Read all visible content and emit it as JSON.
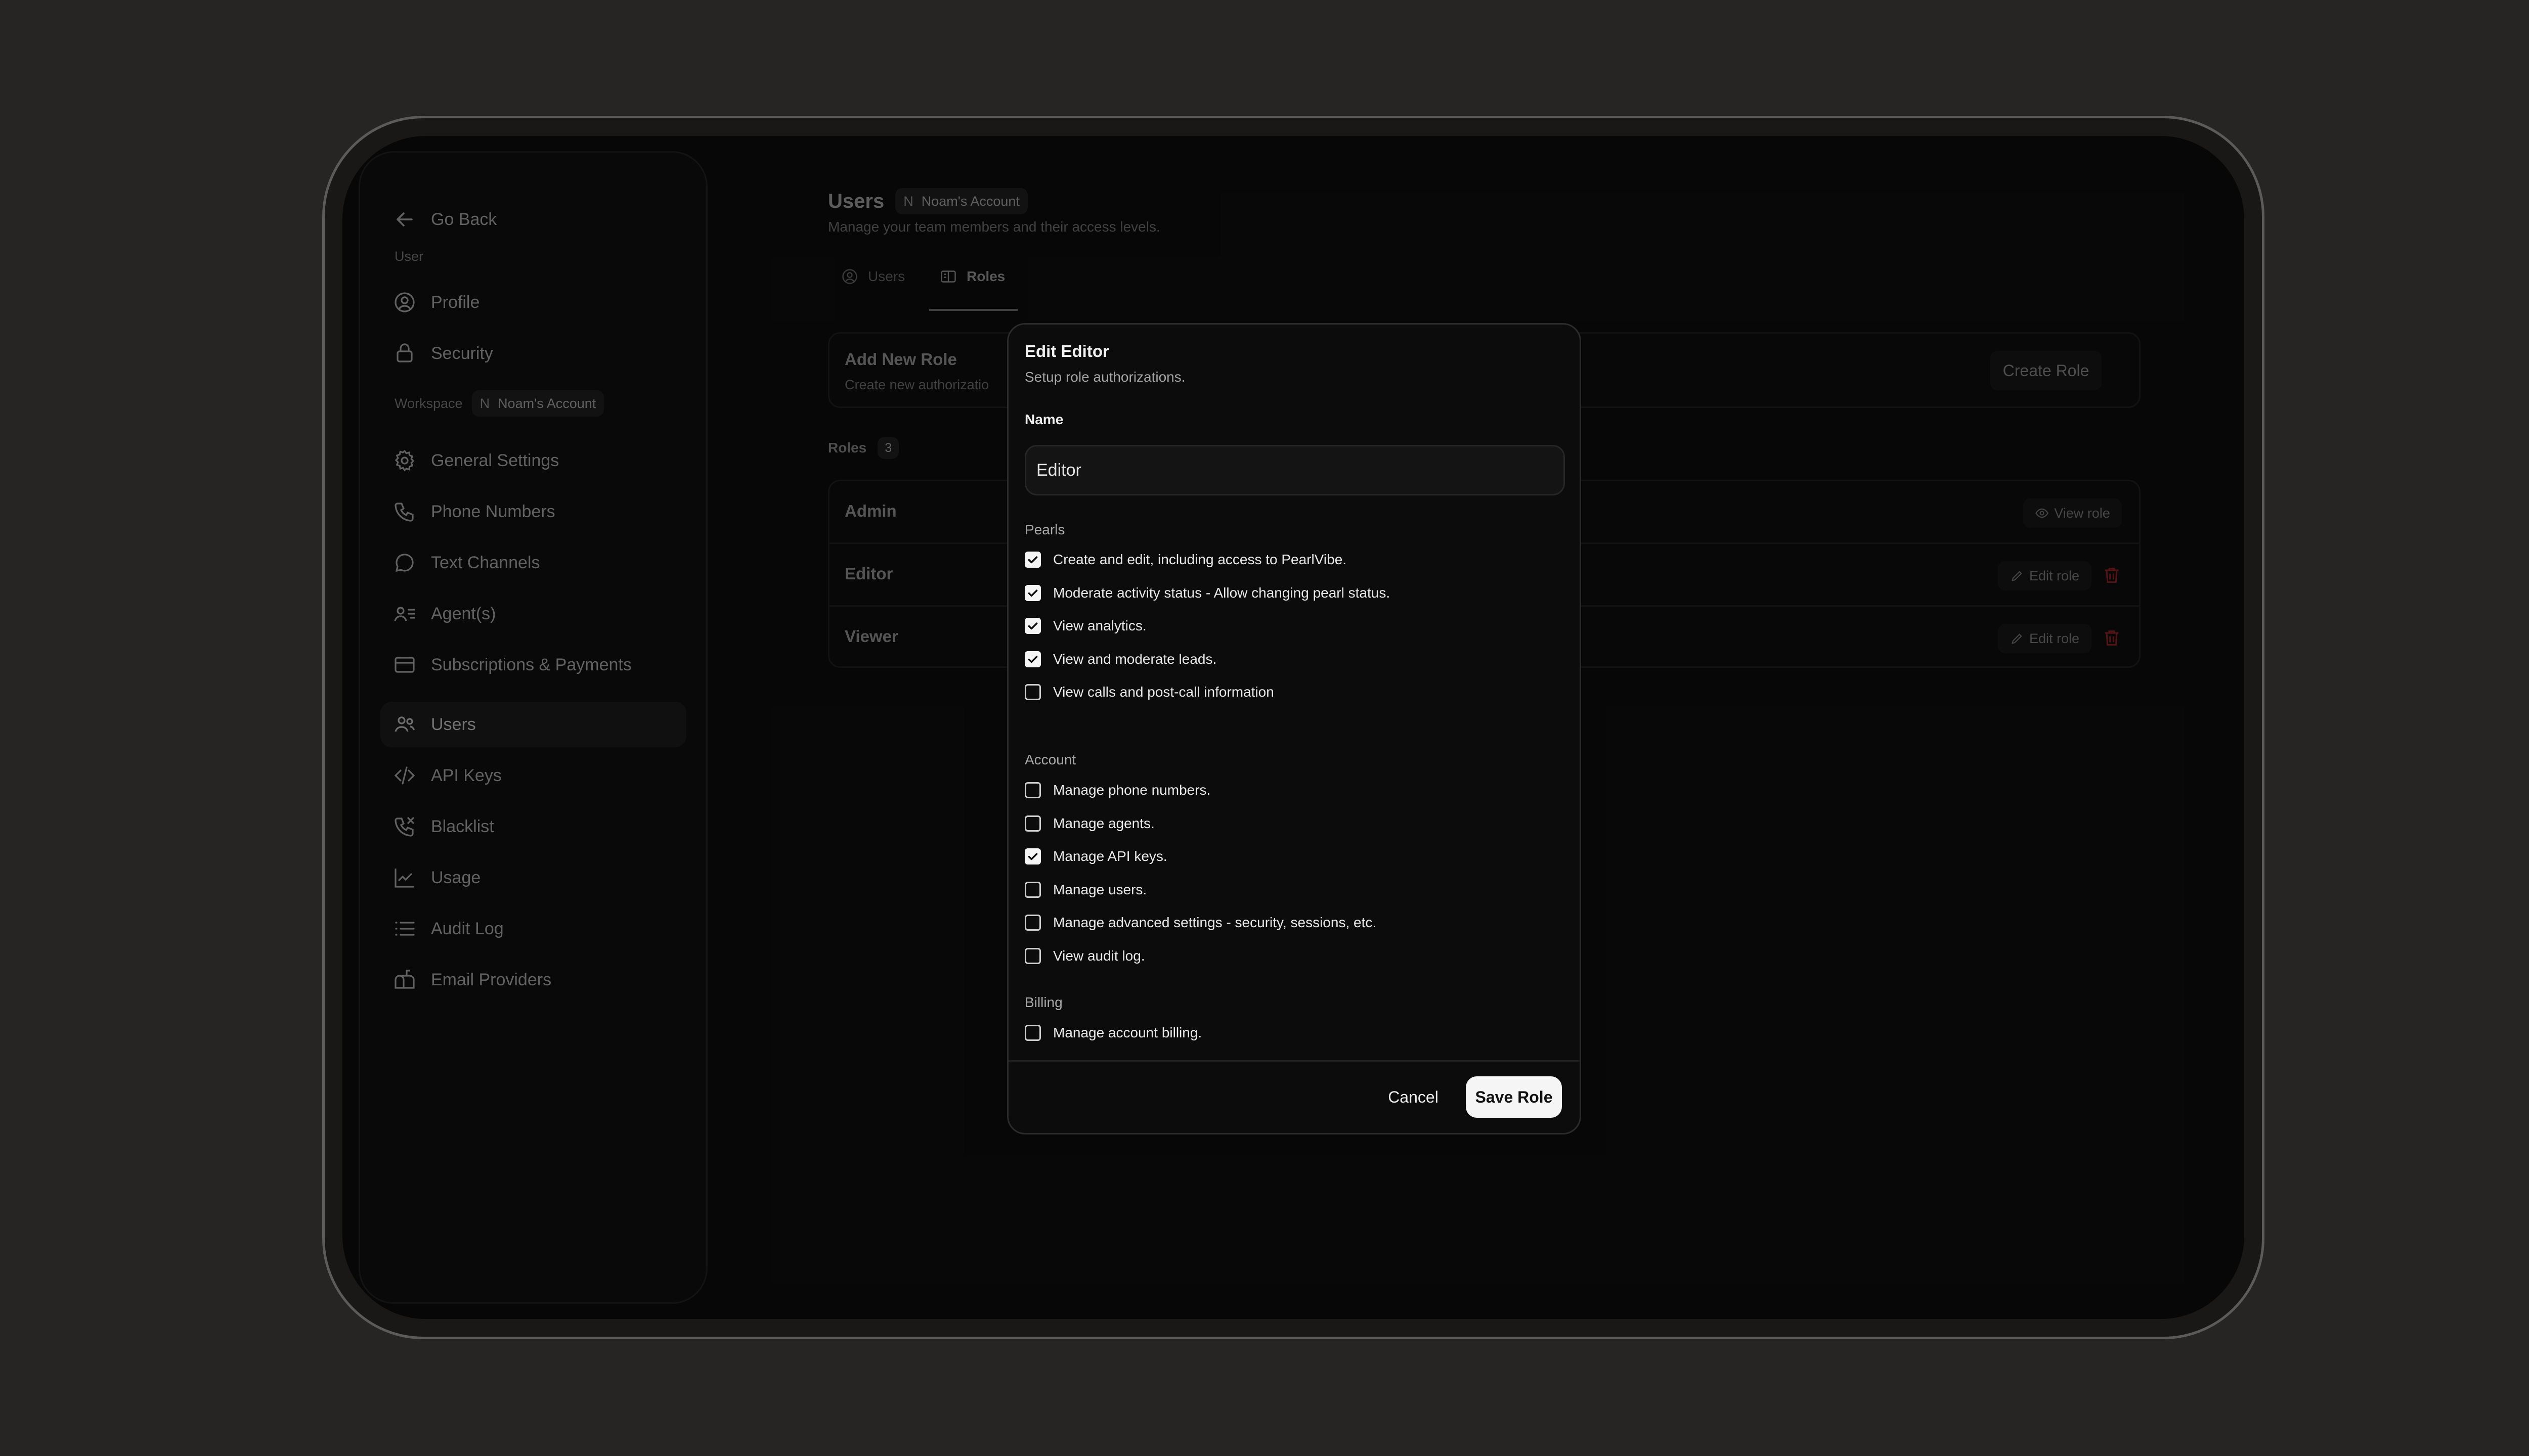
{
  "sidebar": {
    "go_back": "Go Back",
    "user_heading": "User",
    "user_items": [
      {
        "label": "Profile",
        "icon": "profile-icon"
      },
      {
        "label": "Security",
        "icon": "lock-icon"
      }
    ],
    "workspace_heading": "Workspace",
    "workspace_badge_initial": "N",
    "workspace_badge_label": "Noam's Account",
    "workspace_items": [
      {
        "label": "General Settings",
        "icon": "gear-icon"
      },
      {
        "label": "Phone Numbers",
        "icon": "phone-icon"
      },
      {
        "label": "Text Channels",
        "icon": "chat-icon"
      },
      {
        "label": "Agent(s)",
        "icon": "agents-icon"
      },
      {
        "label": "Subscriptions & Payments",
        "icon": "card-icon"
      },
      {
        "label": "Users",
        "icon": "users-icon",
        "active": true
      },
      {
        "label": "API Keys",
        "icon": "code-icon"
      },
      {
        "label": "Blacklist",
        "icon": "phone-blocked-icon"
      },
      {
        "label": "Usage",
        "icon": "chart-icon"
      },
      {
        "label": "Audit Log",
        "icon": "list-icon"
      },
      {
        "label": "Email Providers",
        "icon": "mailbox-icon"
      }
    ]
  },
  "page": {
    "title": "Users",
    "account_badge_initial": "N",
    "account_badge_label": "Noam's Account",
    "subtitle": "Manage your team members and their access levels.",
    "tabs": [
      {
        "label": "Users",
        "active": false
      },
      {
        "label": "Roles",
        "active": true
      }
    ],
    "add_role": {
      "title": "Add New Role",
      "subtitle": "Create new authorizatio",
      "button": "Create Role"
    },
    "roles_heading": "Roles",
    "roles_count": "3",
    "roles": [
      {
        "name": "Admin",
        "action": "View role"
      },
      {
        "name": "Editor",
        "action": "Edit role"
      },
      {
        "name": "Viewer",
        "action": "Edit role"
      }
    ]
  },
  "dialog": {
    "title": "Edit Editor",
    "subtitle": "Setup role authorizations.",
    "name_label": "Name",
    "name_value": "Editor",
    "sections": [
      {
        "title": "Pearls",
        "items": [
          {
            "label": "Create and edit, including access to PearlVibe.",
            "checked": true
          },
          {
            "label": "Moderate activity status - Allow changing pearl status.",
            "checked": true
          },
          {
            "label": "View analytics.",
            "checked": true
          },
          {
            "label": "View and moderate leads.",
            "checked": true
          },
          {
            "label": "View calls and post-call information",
            "checked": false
          }
        ]
      },
      {
        "title": "Account",
        "items": [
          {
            "label": "Manage phone numbers.",
            "checked": false
          },
          {
            "label": "Manage agents.",
            "checked": false
          },
          {
            "label": "Manage API keys.",
            "checked": true
          },
          {
            "label": "Manage users.",
            "checked": false
          },
          {
            "label": "Manage advanced settings - security, sessions, etc.",
            "checked": false
          },
          {
            "label": "View audit log.",
            "checked": false
          }
        ]
      },
      {
        "title": "Billing",
        "items": [
          {
            "label": "Manage account billing.",
            "checked": false
          }
        ]
      }
    ],
    "cancel_label": "Cancel",
    "save_label": "Save Role"
  },
  "colors": {
    "background": "#262523",
    "screen": "#0b0b0b",
    "dialog": "#0c0c0c",
    "danger": "#8a1f1f",
    "primary_button": "#f5f5f5"
  }
}
